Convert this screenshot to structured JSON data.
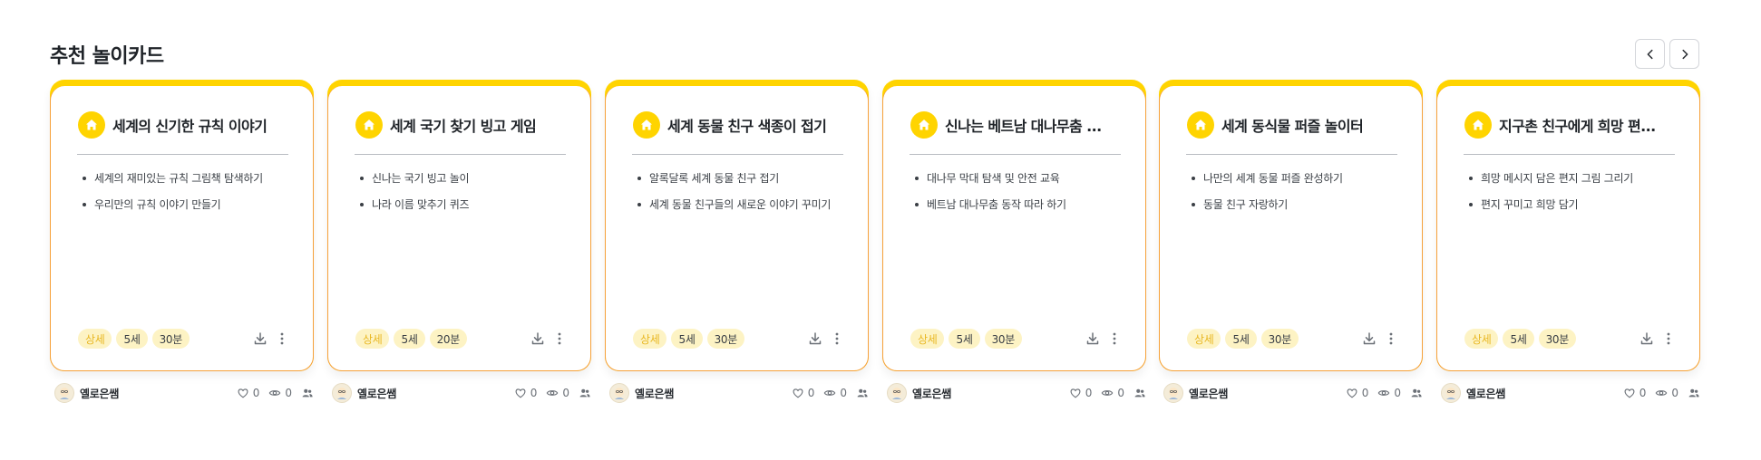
{
  "section": {
    "title": "추천 놀이카드"
  },
  "nav": {
    "prev_icon": "chevron-left-icon",
    "next_icon": "chevron-right-icon"
  },
  "colors": {
    "card_top_accent": "#ffd400",
    "card_border": "#f6a13a",
    "tag_bg": "#fdf3c4",
    "level_text": "#e9b824"
  },
  "cards": [
    {
      "title": "세계의 신기한 규칙 이야기",
      "items": [
        "세계의 재미있는 규칙 그림책 탐색하기",
        "우리만의 규칙 이야기 만들기"
      ],
      "tags": [
        "상세",
        "5세",
        "30분"
      ],
      "author": "옐로은쌤",
      "likes": "0",
      "views": "0"
    },
    {
      "title": "세계 국기 찾기 빙고 게임",
      "items": [
        "신나는 국기 빙고 놀이",
        "나라 이름 맞추기 퀴즈"
      ],
      "tags": [
        "상세",
        "5세",
        "20분"
      ],
      "author": "옐로은쌤",
      "likes": "0",
      "views": "0"
    },
    {
      "title": "세계 동물 친구 색종이 접기",
      "items": [
        "알록달록 세계 동물 친구 접기",
        "세계 동물 친구들의 새로운 이야기 꾸미기"
      ],
      "tags": [
        "상세",
        "5세",
        "30분"
      ],
      "author": "옐로은쌤",
      "likes": "0",
      "views": "0"
    },
    {
      "title": "신나는 베트남 대나무춤 ...",
      "items": [
        "대나무 막대 탐색 및 안전 교육",
        "베트남 대나무춤 동작 따라 하기"
      ],
      "tags": [
        "상세",
        "5세",
        "30분"
      ],
      "author": "옐로은쌤",
      "likes": "0",
      "views": "0"
    },
    {
      "title": "세계 동식물 퍼즐 놀이터",
      "items": [
        "나만의 세계 동물 퍼즐 완성하기",
        "동물 친구 자랑하기"
      ],
      "tags": [
        "상세",
        "5세",
        "30분"
      ],
      "author": "옐로은쌤",
      "likes": "0",
      "views": "0"
    },
    {
      "title": "지구촌 친구에게 희망 편...",
      "items": [
        "희망 메시지 담은 편지 그림 그리기",
        "편지 꾸미고 희망 담기"
      ],
      "tags": [
        "상세",
        "5세",
        "30분"
      ],
      "author": "옐로은쌤",
      "likes": "0",
      "views": "0"
    }
  ]
}
